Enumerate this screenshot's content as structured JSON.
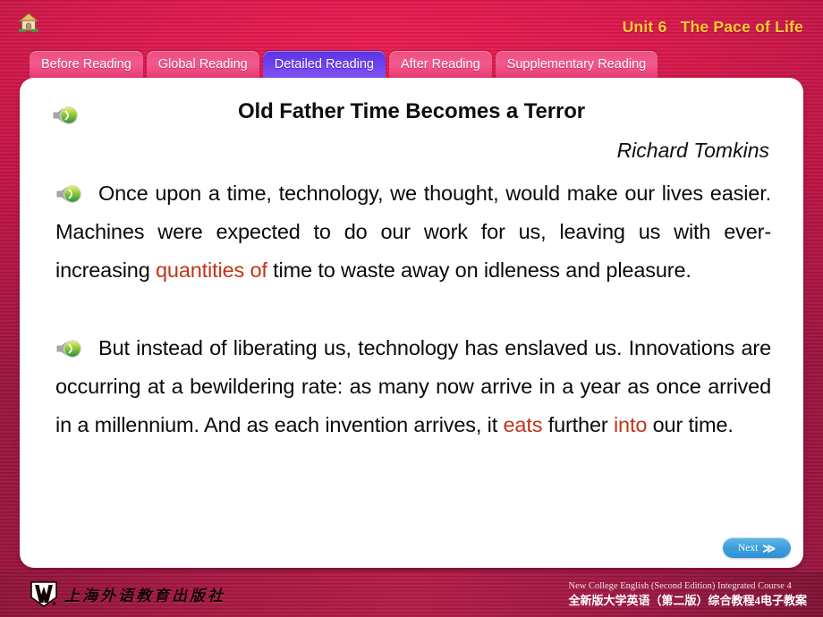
{
  "header": {
    "home_icon": "home-icon",
    "unit_label": "Unit 6",
    "unit_title": "The Pace of Life"
  },
  "tabs": [
    {
      "label": "Before Reading",
      "active": false
    },
    {
      "label": "Global Reading",
      "active": false
    },
    {
      "label": "Detailed Reading",
      "active": true
    },
    {
      "label": "After Reading",
      "active": false
    },
    {
      "label": "Supplementary Reading",
      "active": false
    }
  ],
  "content": {
    "title": "Old Father Time Becomes a Terror",
    "author": "Richard Tomkins",
    "title_audio_icon": "speaker-icon",
    "paragraph1": {
      "audio_icon": "speaker-icon",
      "segments": [
        {
          "text": "Once upon a time, technology, we thought, would make our lives easier. Machines were expected to do our work for us, leaving us with ever-increasing ",
          "highlight": false
        },
        {
          "text": "quantities of",
          "highlight": true
        },
        {
          "text": " time to waste away on idleness and pleasure.",
          "highlight": false
        }
      ]
    },
    "paragraph2": {
      "audio_icon": "speaker-icon",
      "segments": [
        {
          "text": "But instead of liberating us, technology has enslaved us. Innovations are occurring at a bewildering rate: as many now arrive in a year as once arrived in a millennium. And as each invention arrives, it ",
          "highlight": false
        },
        {
          "text": "eats",
          "highlight": true
        },
        {
          "text": " further ",
          "highlight": false
        },
        {
          "text": "into",
          "highlight": true
        },
        {
          "text": " our time.",
          "highlight": false
        }
      ]
    }
  },
  "next_button": {
    "label": "Next",
    "chevron": "≫",
    "icon": "double-chevron-right-icon"
  },
  "footer": {
    "logo_icon": "publisher-logo-icon",
    "publisher_cn": "上海外语教育出版社",
    "line_en": "New College English (Second Edition) Integrated Course 4",
    "line_cn": "全新版大学英语（第二版）综合教程4电子教案"
  },
  "colors": {
    "background_pink": "#d8154a",
    "tab_inactive": "#ee4f80",
    "tab_active": "#6a3ff0",
    "unit_title_gold": "#ffcc33",
    "highlight_red": "#c0351a",
    "next_blue": "#3e9fdd",
    "footer_maroon": "#a4153f"
  }
}
